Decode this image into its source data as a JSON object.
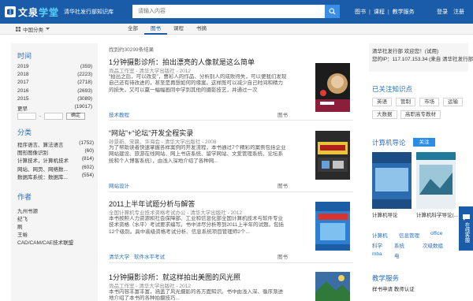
{
  "header": {
    "logo_text": "文泉学堂",
    "logo_sub": "清华社发行部知识库",
    "search_placeholder": "请输入内容",
    "nav": [
      "图书",
      "课程",
      "教学服务"
    ],
    "login": "登录",
    "register": "注册"
  },
  "subbar": {
    "category": "中国分类",
    "tabs": [
      "全部",
      "图书",
      "课程",
      "书摘"
    ],
    "active_tab": "图书"
  },
  "left": {
    "time_title": "时间",
    "years": [
      {
        "year": "2019",
        "count": "(359)"
      },
      {
        "year": "2018",
        "count": "(2223)"
      },
      {
        "year": "2017",
        "count": "(2718)"
      },
      {
        "year": "2016",
        "count": "(2693)"
      },
      {
        "year": "2015",
        "count": "(3089)"
      },
      {
        "year": "更早",
        "count": "(19017)"
      }
    ],
    "range_dash": "-",
    "confirm": "确定",
    "category_title": "分类",
    "categories": [
      {
        "name": "程序语言、算法语言",
        "count": "(1752)"
      },
      {
        "name": "图形图像识别",
        "count": "(60)"
      },
      {
        "name": "计算技术，计算机技术",
        "count": "(814)"
      },
      {
        "name": "网站、网页、网络数...",
        "count": "(602)"
      },
      {
        "name": "数据库系统：数据库...",
        "count": "(554)"
      }
    ],
    "author_title": "作者",
    "authors": [
      "九州书源",
      "纪飞",
      "刷",
      "王裕",
      "CAD/CAM/CAE技术联盟"
    ]
  },
  "results": {
    "count_text": "找到约30299条结果",
    "items": [
      {
        "title": "1分钟摄影诊所：拍出漂亮的人像就是这么简单",
        "meta": "尚品工作室 - 清华大学出版社 - 2012",
        "desc": "“拍出之后，可以改变”，曹彩人的作品、分析别人的成败得失，可以便我们发现自己还有待改进的，甚至是再想如何的缘案。这样既可以减少自己时间和精力的损失，又可以赢一幅幅画同中学到其他的摄影技艺，并通过一次",
        "tags": [
          "技术教程"
        ],
        "type": "图书"
      },
      {
        "title": "“网站”+“论坛”开发全程实录",
        "meta": "孙景新、宋晨、许海会 - 清华大学出版社 - 2008",
        "desc": "为了帮助读者快速掌握各样案例的开发流程，本书通过7个精彩的案例包括企业网站建设、旅游在线网站、网上书店系统、留学网站、文爱管理系统、论坛系统和个人博客系统），由浅入深地介绍了各种网...",
        "tags": [
          "网站设计"
        ],
        "type": "图书"
      },
      {
        "title": "2011上半年试题分析与解答",
        "meta": "全国计算机专业技术资格考试办公 - 清华大学出版社 - 2012",
        "desc": "本书按照人力资源和社会保障部、工业和信息化部全国计算机技术与软件专业技术资格（水平）考试要求编写。书中详尽分析等到2011上半年的试题。包括12个级别。具中高级资格考试分析、信息系统项目管理师2个...",
        "tags": [
          "清华大学",
          "软件水平考试"
        ],
        "type": "图书"
      },
      {
        "title": "1分钟摄影诊所：就这样拍出美图的风光照",
        "meta": "尚品工作室 - 清华大学出版社 - 2012",
        "desc": "本书内容丰富丰富，涵盖了风光摄影的各方面知识。书中由浅入深、循序渐进地介绍了本书的各种拍摄技巧..."
      }
    ]
  },
  "right": {
    "user_line1": "清华社发行部 欢迎您！(试用)",
    "user_line2": "您的IP：117.107.153.34 (来自 清华社发行部)",
    "knowledge_title": "已关注知识点",
    "knowledge_tags": [
      "英语",
      "管制",
      "市场",
      "运输",
      "大数据",
      "高职高专教材"
    ],
    "book_title": "计算机导论",
    "follow": "关注",
    "books": [
      "计算机导论",
      "计算机科学导论(..."
    ],
    "keywords": [
      [
        "计算机",
        "信息管理",
        "office"
      ],
      [
        "科学",
        "系统",
        "次级数组"
      ],
      [
        "mba",
        "电"
      ]
    ],
    "service_title": "教学服务",
    "service_line": "样书申请   教师认证"
  },
  "float": "在线客服"
}
